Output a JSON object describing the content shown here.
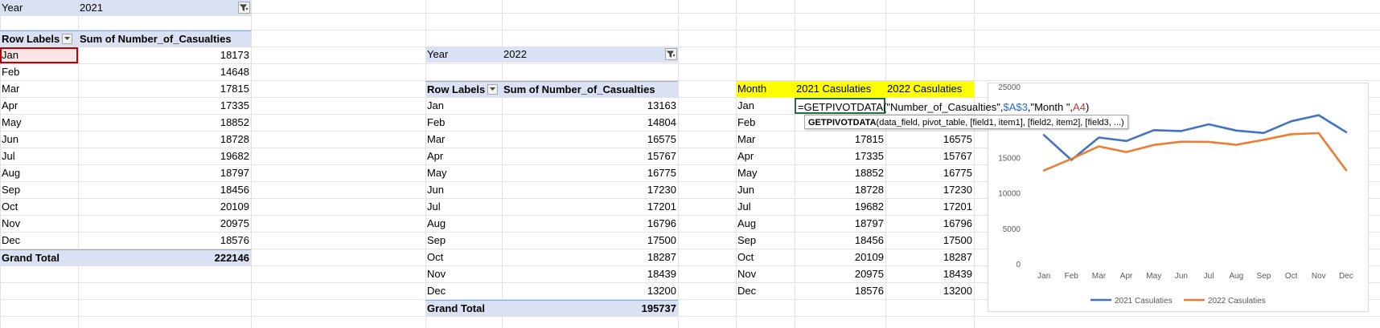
{
  "pivot_2021": {
    "filter_label": "Year",
    "filter_value": "2021",
    "row_labels_header": "Row Labels",
    "value_header": "Sum of Number_of_Casualties",
    "rows": [
      {
        "month": "Jan",
        "value": "18173"
      },
      {
        "month": "Feb",
        "value": "14648"
      },
      {
        "month": "Mar",
        "value": "17815"
      },
      {
        "month": "Apr",
        "value": "17335"
      },
      {
        "month": "May",
        "value": "18852"
      },
      {
        "month": "Jun",
        "value": "18728"
      },
      {
        "month": "Jul",
        "value": "19682"
      },
      {
        "month": "Aug",
        "value": "18797"
      },
      {
        "month": "Sep",
        "value": "18456"
      },
      {
        "month": "Oct",
        "value": "20109"
      },
      {
        "month": "Nov",
        "value": "20975"
      },
      {
        "month": "Dec",
        "value": "18576"
      }
    ],
    "grand_total_label": "Grand Total",
    "grand_total": "222146"
  },
  "pivot_2022": {
    "filter_label": "Year",
    "filter_value": "2022",
    "row_labels_header": "Row Labels",
    "value_header": "Sum of Number_of_Casualties",
    "rows": [
      {
        "month": "Jan",
        "value": "13163"
      },
      {
        "month": "Feb",
        "value": "14804"
      },
      {
        "month": "Mar",
        "value": "16575"
      },
      {
        "month": "Apr",
        "value": "15767"
      },
      {
        "month": "May",
        "value": "16775"
      },
      {
        "month": "Jun",
        "value": "17230"
      },
      {
        "month": "Jul",
        "value": "17201"
      },
      {
        "month": "Aug",
        "value": "16796"
      },
      {
        "month": "Sep",
        "value": "17500"
      },
      {
        "month": "Oct",
        "value": "18287"
      },
      {
        "month": "Nov",
        "value": "18439"
      },
      {
        "month": "Dec",
        "value": "13200"
      }
    ],
    "grand_total_label": "Grand Total",
    "grand_total": "195737"
  },
  "summary_table": {
    "headers": [
      "Month",
      "2021 Casulaties",
      "2022 Casulaties"
    ],
    "rows": [
      {
        "month": "Jan",
        "c2021": "",
        "c2022": ""
      },
      {
        "month": "Feb",
        "c2021": "",
        "c2022": ""
      },
      {
        "month": "Mar",
        "c2021": "17815",
        "c2022": "16575"
      },
      {
        "month": "Apr",
        "c2021": "17335",
        "c2022": "15767"
      },
      {
        "month": "May",
        "c2021": "18852",
        "c2022": "16775"
      },
      {
        "month": "Jun",
        "c2021": "18728",
        "c2022": "17230"
      },
      {
        "month": "Jul",
        "c2021": "19682",
        "c2022": "17201"
      },
      {
        "month": "Aug",
        "c2021": "18797",
        "c2022": "16796"
      },
      {
        "month": "Sep",
        "c2021": "18456",
        "c2022": "17500"
      },
      {
        "month": "Oct",
        "c2021": "20109",
        "c2022": "18287"
      },
      {
        "month": "Nov",
        "c2021": "20975",
        "c2022": "18439"
      },
      {
        "month": "Dec",
        "c2021": "18576",
        "c2022": "13200"
      }
    ]
  },
  "formula_edit": {
    "part_prefix": "=GETPIVOTDATA(\"Number_of_Casualties\",",
    "ref_blue": "$A$3",
    "part_middle": ",\"Month \",",
    "ref_red": "A4",
    "part_suffix": ")",
    "ref_blue_color": "#1f6bd6",
    "ref_red_color": "#d0312d"
  },
  "tooltip": {
    "function_name": "GETPIVOTDATA",
    "args": "(data_field, pivot_table, [field1, item1], [field2, item2], [field3, ...)"
  },
  "chart_data": {
    "type": "line",
    "categories": [
      "Jan",
      "Feb",
      "Mar",
      "Apr",
      "May",
      "Jun",
      "Jul",
      "Aug",
      "Sep",
      "Oct",
      "Nov",
      "Dec"
    ],
    "series": [
      {
        "name": "2021 Casulaties",
        "color": "#4472c4",
        "values": [
          18173,
          14648,
          17815,
          17335,
          18852,
          18728,
          19682,
          18797,
          18456,
          20109,
          20975,
          18576
        ]
      },
      {
        "name": "2022 Casulaties",
        "color": "#ed7d31",
        "values": [
          13163,
          14804,
          16575,
          15767,
          16775,
          17230,
          17201,
          16796,
          17500,
          18287,
          18439,
          13200
        ]
      }
    ],
    "yticks": [
      "0",
      "5000",
      "10000",
      "15000",
      "25000"
    ],
    "ylim": [
      0,
      25000
    ],
    "grid": false,
    "legend_position": "bottom"
  },
  "colors": {
    "pivot_header": "#d9e1f2",
    "highlight_yellow": "#ffff00",
    "selection_red": "#c00000",
    "edit_green": "#217346"
  },
  "icons": {
    "filter": "funnel-filter-icon",
    "dropdown": "chevron-down-icon"
  }
}
